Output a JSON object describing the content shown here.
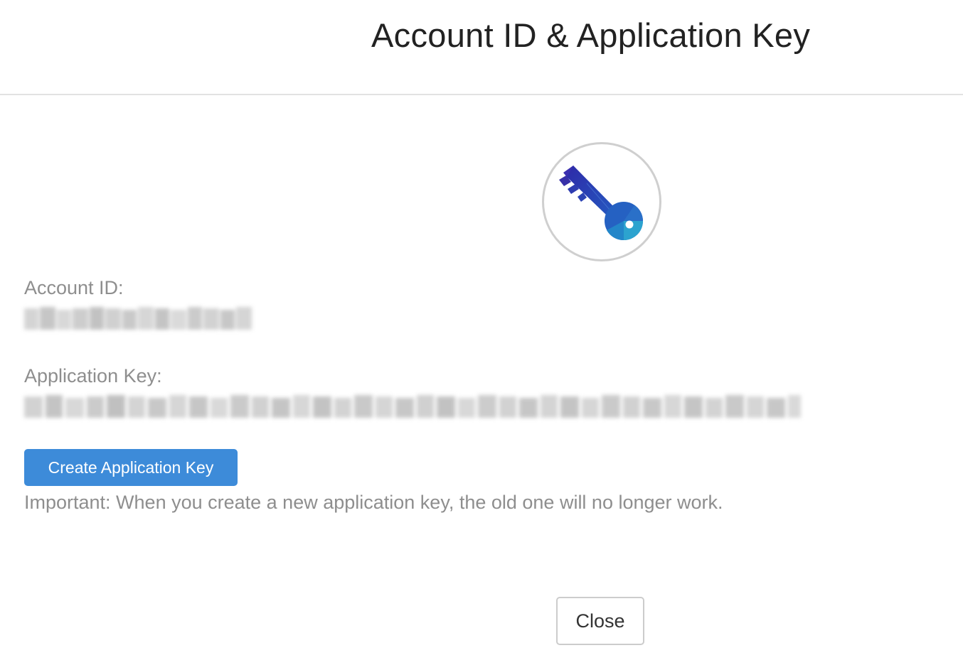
{
  "dialog": {
    "title": "Account ID & Application Key",
    "key_icon": "key-icon"
  },
  "account": {
    "label": "Account ID:",
    "value_state": "obscured"
  },
  "application_key": {
    "label": "Application Key:",
    "value_state": "obscured"
  },
  "actions": {
    "create_label": "Create Application Key",
    "create_color": "#3d8bd9",
    "note": "Important: When you create a new application key, the old one will no longer work.",
    "close_label": "Close"
  }
}
